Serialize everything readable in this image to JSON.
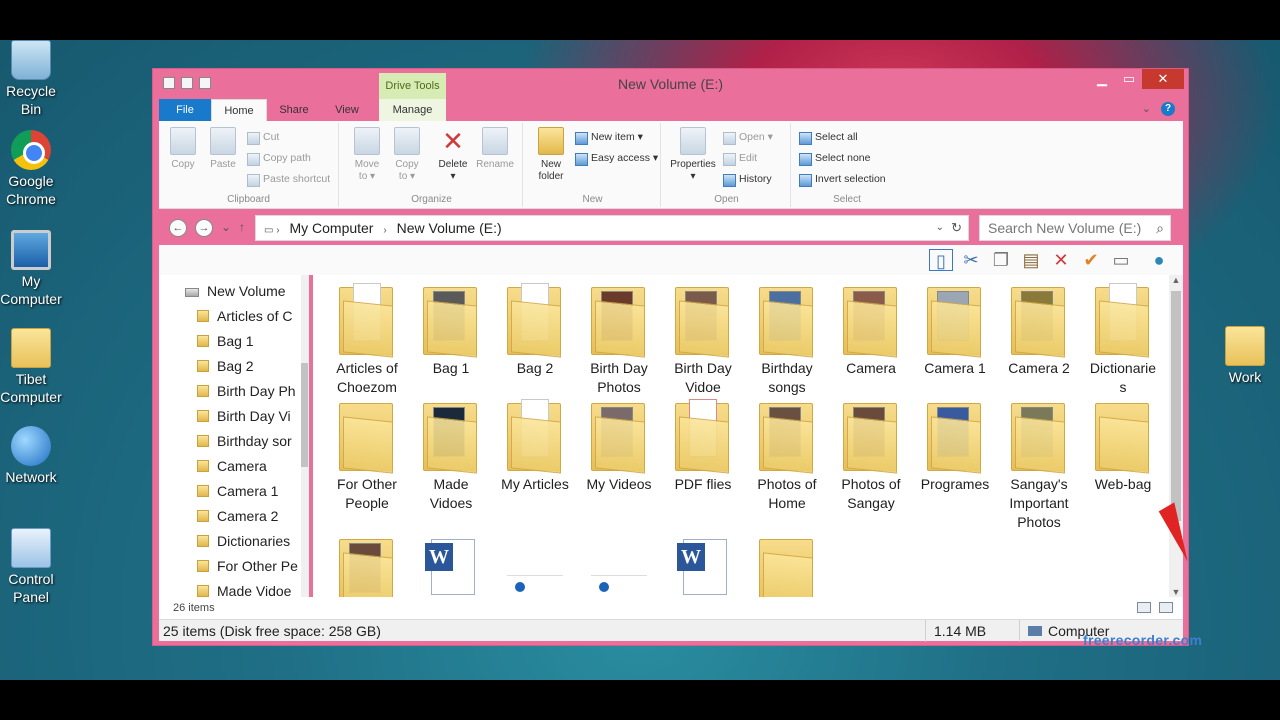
{
  "desktop": {
    "icons": [
      {
        "label": "Recycle Bin",
        "icon": "recycle-bin-icon"
      },
      {
        "label": "Google Chrome",
        "icon": "chrome-icon"
      },
      {
        "label": "My Computer",
        "icon": "computer-icon"
      },
      {
        "label": "Tibet Computer",
        "icon": "user-folder-icon"
      },
      {
        "label": "Network",
        "icon": "network-icon"
      },
      {
        "label": "Control Panel",
        "icon": "control-panel-icon"
      },
      {
        "label": "Work",
        "icon": "folder-icon"
      }
    ],
    "recycle_1": "Recycle",
    "recycle_2": "Bin",
    "chrome_1": "Google",
    "chrome_2": "Chrome",
    "mycomp_1": "My",
    "mycomp_2": "Computer",
    "tibet_1": "Tibet",
    "tibet_2": "Computer",
    "network": "Network",
    "cp_1": "Control",
    "cp_2": "Panel",
    "work": "Work"
  },
  "window": {
    "title": "New Volume (E:)",
    "context_tab": "Drive Tools",
    "colors": {
      "frame": "#eb6f9b",
      "accent": "#1979ca",
      "close": "#c7392f"
    }
  },
  "tabs": {
    "file": "File",
    "home": "Home",
    "share": "Share",
    "view": "View",
    "manage": "Manage"
  },
  "ribbon": {
    "clipboard": {
      "copy": "Copy",
      "paste": "Paste",
      "cut": "Cut",
      "copy_path": "Copy path",
      "paste_shortcut": "Paste shortcut",
      "label": "Clipboard"
    },
    "organize": {
      "move_1": "Move",
      "move_2": "to ▾",
      "copy_1": "Copy",
      "copy_2": "to ▾",
      "delete": "Delete",
      "delete_dd": "▾",
      "rename": "Rename",
      "label": "Organize"
    },
    "new": {
      "new_folder_1": "New",
      "new_folder_2": "folder",
      "new_item": "New item ▾",
      "easy_access": "Easy access ▾",
      "label": "New"
    },
    "open": {
      "properties": "Properties",
      "properties_dd": "▾",
      "open": "Open ▾",
      "edit": "Edit",
      "history": "History",
      "label": "Open"
    },
    "select": {
      "select_all": "Select all",
      "select_none": "Select none",
      "invert": "Invert selection",
      "label": "Select"
    }
  },
  "address": {
    "crumbs": [
      "My Computer",
      "New Volume (E:)"
    ],
    "search_placeholder": "Search New Volume (E:)"
  },
  "nav": {
    "root": "New Volume",
    "items": [
      "Articles of C",
      "Bag 1",
      "Bag 2",
      "Birth Day Ph",
      "Birth Day Vi",
      "Birthday sor",
      "Camera",
      "Camera 1",
      "Camera 2",
      "Dictionaries",
      "For Other Pe",
      "Made Vidoe"
    ]
  },
  "content": {
    "row1": [
      {
        "l1": "Articles of",
        "l2": "Choezom"
      },
      {
        "l1": "Bag 1",
        "l2": ""
      },
      {
        "l1": "Bag 2",
        "l2": ""
      },
      {
        "l1": "Birth Day",
        "l2": "Photos"
      },
      {
        "l1": "Birth Day",
        "l2": "Vidoe"
      },
      {
        "l1": "Birthday",
        "l2": "songs"
      },
      {
        "l1": "Camera",
        "l2": ""
      },
      {
        "l1": "Camera 1",
        "l2": ""
      },
      {
        "l1": "Camera 2",
        "l2": ""
      },
      {
        "l1": "Dictionarie",
        "l2": "s"
      }
    ],
    "row2": [
      {
        "l1": "For Other",
        "l2": "People",
        "l3": ""
      },
      {
        "l1": "Made",
        "l2": "Vidoes",
        "l3": ""
      },
      {
        "l1": "My Articles",
        "l2": "",
        "l3": ""
      },
      {
        "l1": "My Videos",
        "l2": "",
        "l3": ""
      },
      {
        "l1": "PDF flies",
        "l2": "",
        "l3": ""
      },
      {
        "l1": "Photos of",
        "l2": "Home",
        "l3": ""
      },
      {
        "l1": "Photos of",
        "l2": "Sangay",
        "l3": ""
      },
      {
        "l1": "Programes",
        "l2": "",
        "l3": ""
      },
      {
        "l1": "Sangay's",
        "l2": "Important",
        "l3": "Photos"
      },
      {
        "l1": "Web-bag",
        "l2": "",
        "l3": ""
      }
    ]
  },
  "status": {
    "item_count": "26 items",
    "summary": "25 items (Disk free space: 258 GB)",
    "size": "1.14 MB",
    "location": "Computer"
  },
  "watermark": "freerecorder.com"
}
